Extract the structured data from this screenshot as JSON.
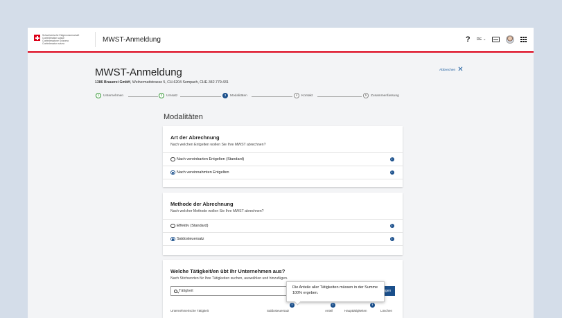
{
  "logo": {
    "lines": [
      "Schweizerische Eidgenossenschaft",
      "Confédération suisse",
      "Confederazione Svizzera",
      "Confederaziun svizra"
    ]
  },
  "header": {
    "app_title": "MWST-Anmeldung",
    "help": "?",
    "language": "DE",
    "language_chevron": "⌄"
  },
  "page": {
    "title": "MWST-Anmeldung",
    "company_name": "1386 Brauerei GmbH",
    "company_address": ", Weihermattstrasse 5, CH-6204 Sempach, CHE-342.779.431",
    "cancel_label": "Abbrechen",
    "cancel_icon": "✕",
    "section_title": "Modalitäten"
  },
  "steps": [
    {
      "num": "1",
      "label": "Unternehmen",
      "state": "done"
    },
    {
      "num": "2",
      "label": "Umsatz",
      "state": "done"
    },
    {
      "num": "3",
      "label": "Modalitäten",
      "state": "active"
    },
    {
      "num": "4",
      "label": "Kontakt",
      "state": "todo"
    },
    {
      "num": "5",
      "label": "Zusammenfassung",
      "state": "todo"
    }
  ],
  "card1": {
    "title": "Art der Abrechnung",
    "subtitle": "Nach welchen Entgelten wollen Sie Ihre MWST abrechnen?",
    "options": [
      {
        "label": "Nach vereinbarten Entgelten (Standard)",
        "checked": false
      },
      {
        "label": "Nach vereinnahmten Entgelten",
        "checked": true
      }
    ]
  },
  "card2": {
    "title": "Methode der Abrechnung",
    "subtitle": "Nach welcher Methode wollen Sie Ihre MWST abrechnen?",
    "options": [
      {
        "label": "Effektiv (Standard)",
        "checked": false
      },
      {
        "label": "Saldosteuersatz",
        "checked": true
      }
    ]
  },
  "card3": {
    "title": "Welche Tätigkeit/en übt Ihr Unternehmen aus?",
    "subtitle": "Nach Stichworten für Ihre Tätigkeiten suchen, auswählen und hinzufügen.",
    "search_placeholder": "Tätigkeit",
    "add_button": "fügen",
    "tooltip": "Die Anteile aller Tätigkeiten müssen in der Summe 100% ergeben.",
    "columns": [
      "Unternehmerische Tätigkeit",
      "Saldosteuersatz",
      "Anteil",
      "Haupttätigkeiten",
      "Löschen"
    ]
  },
  "info_glyph": "i",
  "colors": {
    "brand_red": "#dc0018",
    "primary_blue": "#1a4f8b",
    "success_green": "#3a9a3a"
  }
}
